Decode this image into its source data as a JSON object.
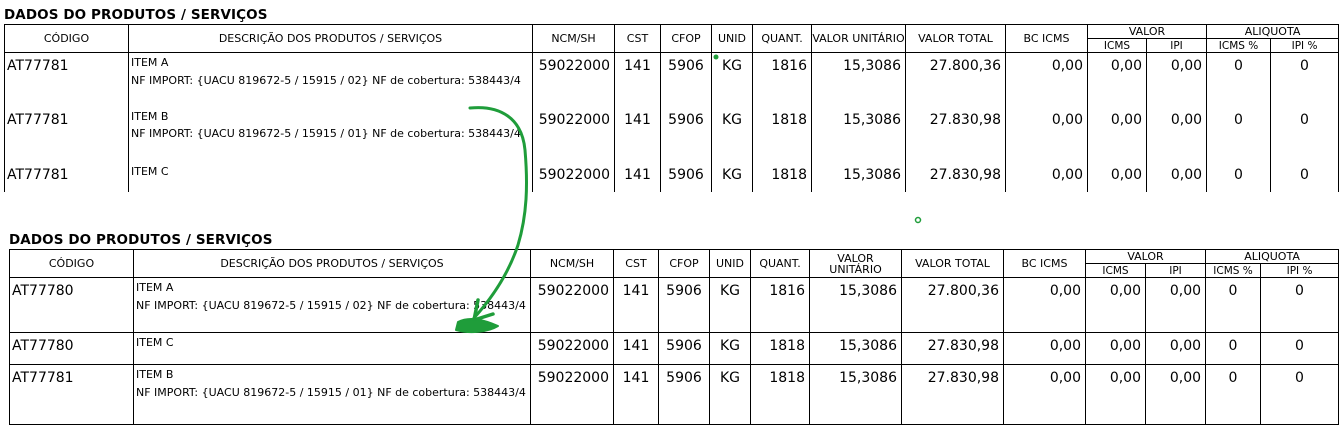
{
  "section_title": "DADOS DO PRODUTOS / SERVIÇOS",
  "headers": {
    "codigo": "CÓDIGO",
    "descricao": "DESCRIÇÃO DOS PRODUTOS / SERVIÇOS",
    "ncm": "NCM/SH",
    "cst": "CST",
    "cfop": "CFOP",
    "unid": "UNID",
    "quant": "QUANT.",
    "valor_unitario": "VALOR UNITÁRIO",
    "valor_total": "VALOR  TOTAL",
    "bc_icms": "BC ICMS",
    "valor": "VALOR",
    "aliquota": "ALIQUOTA",
    "icms": "ICMS",
    "ipi": "IPI",
    "icms_pct": "ICMS %",
    "ipi_pct": "IPI %"
  },
  "table1": {
    "rows": [
      {
        "codigo": "AT77781",
        "item": "ITEM A",
        "note": "NF IMPORT: {UACU 819672-5 / 15915 / 02} NF de cobertura: 538443/4",
        "ncm": "59022000",
        "cst": "141",
        "cfop": "5906",
        "unid": "KG",
        "quant": "1816",
        "valor_unitario": "15,3086",
        "valor_total": "27.800,36",
        "bc_icms": "0,00",
        "valor_icms": "0,00",
        "valor_ipi": "0,00",
        "aliq_icms": "0",
        "aliq_ipi": "0"
      },
      {
        "codigo": "AT77781",
        "item": "ITEM B",
        "note": "NF IMPORT: {UACU 819672-5 / 15915 / 01} NF de cobertura: 538443/4",
        "ncm": "59022000",
        "cst": "141",
        "cfop": "5906",
        "unid": "KG",
        "quant": "1818",
        "valor_unitario": "15,3086",
        "valor_total": "27.830,98",
        "bc_icms": "0,00",
        "valor_icms": "0,00",
        "valor_ipi": "0,00",
        "aliq_icms": "0",
        "aliq_ipi": "0"
      },
      {
        "codigo": "AT77781",
        "item": "ITEM C",
        "note": "",
        "ncm": "59022000",
        "cst": "141",
        "cfop": "5906",
        "unid": "KG",
        "quant": "1818",
        "valor_unitario": "15,3086",
        "valor_total": "27.830,98",
        "bc_icms": "0,00",
        "valor_icms": "0,00",
        "valor_ipi": "0,00",
        "aliq_icms": "0",
        "aliq_ipi": "0"
      }
    ]
  },
  "table2": {
    "rows": [
      {
        "codigo": "AT77780",
        "item": "ITEM A",
        "note": "NF IMPORT: {UACU 819672-5 / 15915 / 02} NF de cobertura: 538443/4",
        "ncm": "59022000",
        "cst": "141",
        "cfop": "5906",
        "unid": "KG",
        "quant": "1816",
        "valor_unitario": "15,3086",
        "valor_total": "27.800,36",
        "bc_icms": "0,00",
        "valor_icms": "0,00",
        "valor_ipi": "0,00",
        "aliq_icms": "0",
        "aliq_ipi": "0"
      },
      {
        "codigo": "AT77780",
        "item": "ITEM C",
        "note": "",
        "ncm": "59022000",
        "cst": "141",
        "cfop": "5906",
        "unid": "KG",
        "quant": "1818",
        "valor_unitario": "15,3086",
        "valor_total": "27.830,98",
        "bc_icms": "0,00",
        "valor_icms": "0,00",
        "valor_ipi": "0,00",
        "aliq_icms": "0",
        "aliq_ipi": "0"
      },
      {
        "codigo": "AT77781",
        "item": "ITEM B",
        "note": "NF IMPORT: {UACU 819672-5 / 15915 / 01} NF de cobertura: 538443/4",
        "ncm": "59022000",
        "cst": "141",
        "cfop": "5906",
        "unid": "KG",
        "quant": "1818",
        "valor_unitario": "15,3086",
        "valor_total": "27.830,98",
        "bc_icms": "0,00",
        "valor_icms": "0,00",
        "valor_ipi": "0,00",
        "aliq_icms": "0",
        "aliq_ipi": "0"
      }
    ]
  },
  "annotation": {
    "color": "#1f9d3a",
    "icon": "hand-drawn-arrow"
  }
}
